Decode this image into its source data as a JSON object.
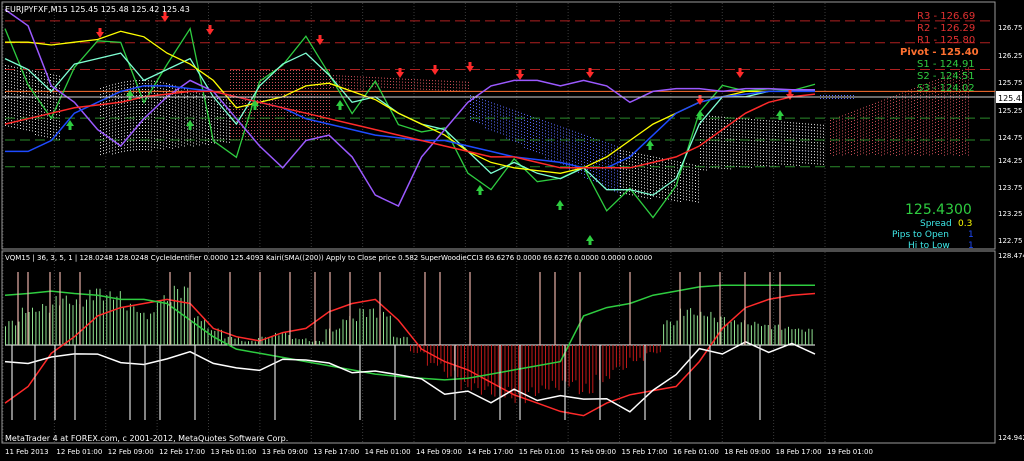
{
  "window": {
    "symbol_info": "EURJPYFXF,M15  125.45 125.48 125.42 125.43",
    "indicator_line": "VQM15 | 36, 3, 5, 1 |   128.0248 128.0248  CycleIdentifier 0.0000 125.4093  Kairi(SMA((200)) Apply to Close price 0.582  SuperWoodieCCI3 69.6276 0.0000 69.6276 0.0000 0.0000 0.0000",
    "copyright": "MetaTrader 4 at FOREX.com, c 2001-2012, MetaQuotes Software Corp."
  },
  "pivots": [
    {
      "label": "R3 - 126.69",
      "color": "#e03030"
    },
    {
      "label": "R2 - 126.29",
      "color": "#e03030"
    },
    {
      "label": "R1 - 125.80",
      "color": "#e03030"
    },
    {
      "label": "Pivot - 125.40",
      "color": "#ff7030"
    },
    {
      "label": "S1 - 124.91",
      "color": "#2ecc40"
    },
    {
      "label": "S2 - 124.51",
      "color": "#2ecc40"
    },
    {
      "label": "S3 - 124.02",
      "color": "#2ecc40"
    }
  ],
  "info_panel": {
    "price": "125.4300",
    "spread_label": "Spread",
    "spread_value": "0.3",
    "pips_label": "Pips to Open",
    "pips_value": "1",
    "hilo_label": "Hi to Low",
    "hilo_value": "1"
  },
  "price_scale": [
    "126.75",
    "126.25",
    "125.75",
    "125.25",
    "124.75",
    "124.25",
    "123.75",
    "123.25",
    "122.75"
  ],
  "current_price_tag": "125.43",
  "osc_scale_top": "128.474",
  "osc_scale_bottom": "124.942",
  "colors": {
    "background": "#000000",
    "price_line": "#ffffff",
    "close_line": "#2ecc40",
    "cyan_line": "#7fffd4",
    "yellow_line": "#ffff00",
    "purple_line": "#9b59ff",
    "blue_line": "#1e4bff",
    "red_line": "#ff2a2a",
    "cloud_red": "#d0505a",
    "cloud_white": "#e8e8e8",
    "cloud_blue": "#5a6cff"
  },
  "chart_data": [
    {
      "type": "line",
      "title": "",
      "x_ticks": [
        "11 Feb 2013",
        "12 Feb 01:00",
        "12 Feb 09:00",
        "12 Feb 17:00",
        "13 Feb 01:00",
        "13 Feb 09:00",
        "13 Feb 17:00",
        "14 Feb 01:00",
        "14 Feb 09:00",
        "14 Feb 17:00",
        "15 Feb 01:00",
        "15 Feb 09:00",
        "15 Feb 17:00",
        "16 Feb 01:00",
        "18 Feb 09:00",
        "18 Feb 17:00",
        "19 Feb 01:00"
      ],
      "ylim": [
        122.55,
        127.0
      ],
      "grid": true,
      "series": [
        {
          "name": "",
          "values": [
            126.55,
            125.6,
            124.8,
            125.9,
            126.35,
            126.2,
            125.3,
            125.85,
            126.5,
            124.6,
            124.1,
            125.6,
            125.95,
            126.3,
            125.8,
            125.0,
            125.5,
            124.9,
            124.6,
            124.7,
            124.0,
            123.5,
            124.2,
            123.8,
            123.7,
            124.1,
            123.2,
            123.55,
            123.2,
            123.6,
            125.0,
            125.6,
            125.3,
            125.5,
            125.45,
            125.43
          ]
        },
        {
          "name": "",
          "values": [
            126.0,
            125.8,
            125.4,
            125.9,
            126.0,
            126.1,
            125.6,
            125.8,
            126.0,
            125.3,
            124.8,
            125.5,
            125.9,
            126.1,
            125.7,
            125.2,
            125.3,
            125.0,
            124.8,
            124.7,
            124.3,
            123.9,
            124.1,
            123.9,
            123.8,
            124.0,
            123.6,
            123.6,
            123.5,
            123.8,
            124.8,
            125.3,
            125.3,
            125.4,
            125.4,
            125.42
          ]
        },
        {
          "name": "",
          "values": [
            126.3,
            126.3,
            126.25,
            126.3,
            126.35,
            126.5,
            126.4,
            126.1,
            125.9,
            125.6,
            125.1,
            125.2,
            125.3,
            125.5,
            125.55,
            125.4,
            125.25,
            125.0,
            124.8,
            124.6,
            124.3,
            124.1,
            124.0,
            123.95,
            123.9,
            124.0,
            124.2,
            124.5,
            124.8,
            125.0,
            125.2,
            125.3,
            125.4,
            125.4,
            125.4,
            125.4
          ]
        },
        {
          "name": "",
          "values": [
            126.9,
            126.6,
            125.5,
            125.2,
            124.7,
            124.4,
            124.9,
            125.3,
            125.6,
            125.4,
            124.9,
            124.4,
            124.0,
            124.5,
            124.6,
            124.2,
            123.5,
            123.3,
            124.2,
            124.7,
            125.2,
            125.5,
            125.6,
            125.6,
            125.5,
            125.6,
            125.5,
            125.2,
            125.4,
            125.45,
            125.45,
            125.4,
            125.45,
            125.45,
            125.43,
            125.43
          ]
        },
        {
          "name": "",
          "values": [
            124.3,
            124.3,
            124.5,
            125.0,
            125.2,
            125.4,
            125.5,
            125.5,
            125.45,
            125.4,
            125.3,
            125.2,
            125.1,
            124.9,
            124.8,
            124.7,
            124.6,
            124.55,
            124.5,
            124.5,
            124.4,
            124.3,
            124.2,
            124.15,
            124.1,
            124.0,
            124.0,
            124.2,
            124.6,
            125.0,
            125.2,
            125.3,
            125.35,
            125.4,
            125.4,
            125.4
          ]
        },
        {
          "name": "",
          "values": [
            124.8,
            124.9,
            125.0,
            125.1,
            125.15,
            125.2,
            125.3,
            125.35,
            125.4,
            125.4,
            125.3,
            125.2,
            125.1,
            125.0,
            124.9,
            124.8,
            124.7,
            124.6,
            124.5,
            124.4,
            124.3,
            124.2,
            124.2,
            124.1,
            124.0,
            124.0,
            124.0,
            124.0,
            124.1,
            124.2,
            124.4,
            124.7,
            125.0,
            125.2,
            125.3,
            125.35
          ]
        }
      ]
    },
    {
      "type": "bar",
      "title": "",
      "ylim": [
        -100,
        100
      ],
      "histogram": [
        30,
        45,
        50,
        60,
        55,
        70,
        65,
        50,
        40,
        60,
        72,
        35,
        20,
        10,
        5,
        10,
        15,
        8,
        5,
        20,
        35,
        45,
        40,
        10,
        -10,
        -25,
        -40,
        -55,
        -60,
        -65,
        -70,
        -62,
        -55,
        -50,
        -60,
        -45,
        -30,
        -20,
        -10,
        30,
        45,
        40,
        35,
        30,
        28,
        25,
        22,
        20
      ],
      "series": [
        {
          "name": "",
          "values": [
            -70,
            -50,
            -10,
            10,
            35,
            45,
            50,
            55,
            50,
            20,
            10,
            5,
            15,
            20,
            40,
            50,
            55,
            30,
            -5,
            -20,
            -30,
            -45,
            -60,
            -70,
            -80,
            -85,
            -70,
            -60,
            -55,
            -50,
            -20,
            20,
            45,
            55,
            60,
            62
          ]
        },
        {
          "name": "",
          "values": [
            60,
            62,
            65,
            62,
            60,
            55,
            55,
            50,
            30,
            10,
            -5,
            -10,
            -15,
            -20,
            -25,
            -30,
            -35,
            -38,
            -40,
            -42,
            -40,
            -35,
            -30,
            -25,
            -20,
            35,
            45,
            50,
            60,
            65,
            70,
            72,
            72,
            72,
            72,
            72
          ]
        },
        {
          "name": "",
          "values": [
            -20,
            -22,
            -15,
            -10,
            -12,
            -20,
            -25,
            -15,
            -10,
            -20,
            -30,
            -28,
            -20,
            -15,
            -25,
            -30,
            -35,
            -32,
            -45,
            -55,
            -60,
            -65,
            -58,
            -62,
            -66,
            -60,
            -70,
            -75,
            -60,
            -30,
            -10,
            -5,
            -2,
            -3,
            -4,
            -5
          ]
        }
      ]
    }
  ]
}
